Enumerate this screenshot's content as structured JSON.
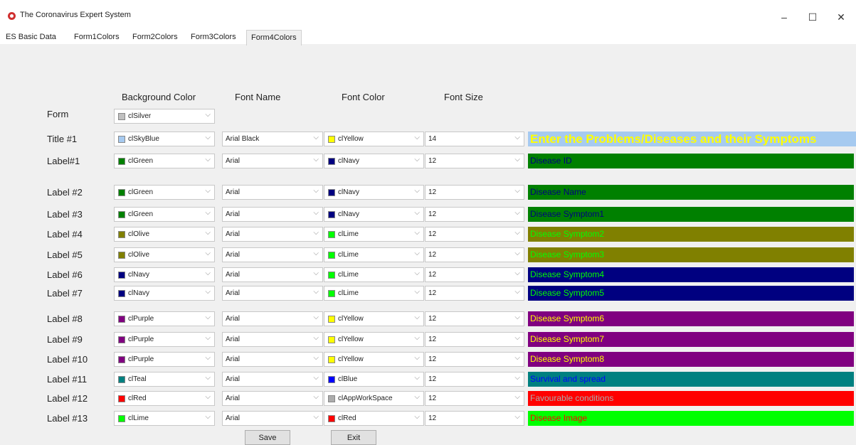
{
  "window": {
    "title": "The Coronavirus Expert System",
    "controls": {
      "minimize": "–",
      "maximize": "☐",
      "close": "✕"
    }
  },
  "tabs": [
    {
      "label": "ES Basic Data",
      "active": false
    },
    {
      "label": "Form1Colors",
      "active": false
    },
    {
      "label": "Form2Colors",
      "active": false
    },
    {
      "label": "Form3Colors",
      "active": false
    },
    {
      "label": "Form4Colors",
      "active": true
    }
  ],
  "headers": {
    "background": "Background Color",
    "font_name": "Font Name",
    "font_color": "Font Color",
    "font_size": "Font Size"
  },
  "form_row": {
    "label": "Form",
    "background": {
      "name": "clSilver",
      "hex": "#c0c0c0"
    }
  },
  "rows": [
    {
      "label": "Title #1",
      "bg": {
        "name": "clSkyBlue",
        "hex": "#a6caf0"
      },
      "font": "Arial Black",
      "fc": {
        "name": "clYellow",
        "hex": "#ffff00"
      },
      "size": "14",
      "preview": "Enter the Problems/Diseases and their Symptoms"
    },
    {
      "label": "Label#1",
      "bg": {
        "name": "clGreen",
        "hex": "#008000"
      },
      "font": "Arial",
      "fc": {
        "name": "clNavy",
        "hex": "#000080"
      },
      "size": "12",
      "preview": "Disease ID"
    },
    {
      "label": "Label #2",
      "bg": {
        "name": "clGreen",
        "hex": "#008000"
      },
      "font": "Arial",
      "fc": {
        "name": "clNavy",
        "hex": "#000080"
      },
      "size": "12",
      "preview": "Disease Name"
    },
    {
      "label": "Label #3",
      "bg": {
        "name": "clGreen",
        "hex": "#008000"
      },
      "font": "Arial",
      "fc": {
        "name": "clNavy",
        "hex": "#000080"
      },
      "size": "12",
      "preview": "Disease Symptom1"
    },
    {
      "label": "Label #4",
      "bg": {
        "name": "clOlive",
        "hex": "#808000"
      },
      "font": "Arial",
      "fc": {
        "name": "clLime",
        "hex": "#00ff00"
      },
      "size": "12",
      "preview": "Disease Symptom2"
    },
    {
      "label": "Label #5",
      "bg": {
        "name": "clOlive",
        "hex": "#808000"
      },
      "font": "Arial",
      "fc": {
        "name": "clLime",
        "hex": "#00ff00"
      },
      "size": "12",
      "preview": "Disease Symptom3"
    },
    {
      "label": "Label #6",
      "bg": {
        "name": "clNavy",
        "hex": "#000080"
      },
      "font": "Arial",
      "fc": {
        "name": "clLime",
        "hex": "#00ff00"
      },
      "size": "12",
      "preview": "Disease Symptom4"
    },
    {
      "label": "Label #7",
      "bg": {
        "name": "clNavy",
        "hex": "#000080"
      },
      "font": "Arial",
      "fc": {
        "name": "clLime",
        "hex": "#00ff00"
      },
      "size": "12",
      "preview": "Disease Symptom5"
    },
    {
      "label": "Label #8",
      "bg": {
        "name": "clPurple",
        "hex": "#800080"
      },
      "font": "Arial",
      "fc": {
        "name": "clYellow",
        "hex": "#ffff00"
      },
      "size": "12",
      "preview": "Disease Symptom6"
    },
    {
      "label": "Label #9",
      "bg": {
        "name": "clPurple",
        "hex": "#800080"
      },
      "font": "Arial",
      "fc": {
        "name": "clYellow",
        "hex": "#ffff00"
      },
      "size": "12",
      "preview": "Disease Symptom7"
    },
    {
      "label": "Label #10",
      "bg": {
        "name": "clPurple",
        "hex": "#800080"
      },
      "font": "Arial",
      "fc": {
        "name": "clYellow",
        "hex": "#ffff00"
      },
      "size": "12",
      "preview": "Disease Symptom8"
    },
    {
      "label": "Label #11",
      "bg": {
        "name": "clTeal",
        "hex": "#008080"
      },
      "font": "Arial",
      "fc": {
        "name": "clBlue",
        "hex": "#0000ff"
      },
      "size": "12",
      "preview": "Survival and spread"
    },
    {
      "label": "Label #12",
      "bg": {
        "name": "clRed",
        "hex": "#ff0000"
      },
      "font": "Arial",
      "fc": {
        "name": "clAppWorkSpace",
        "hex": "#ababab"
      },
      "size": "12",
      "preview": "Favourable conditions"
    },
    {
      "label": "Label #13",
      "bg": {
        "name": "clLime",
        "hex": "#00ff00"
      },
      "font": "Arial",
      "fc": {
        "name": "clRed",
        "hex": "#ff0000"
      },
      "size": "12",
      "preview": "Disease Image"
    }
  ],
  "buttons": {
    "save": "Save",
    "exit": "Exit"
  },
  "icons": {
    "dropdown": "chevron-down-icon",
    "app": "app-icon"
  }
}
